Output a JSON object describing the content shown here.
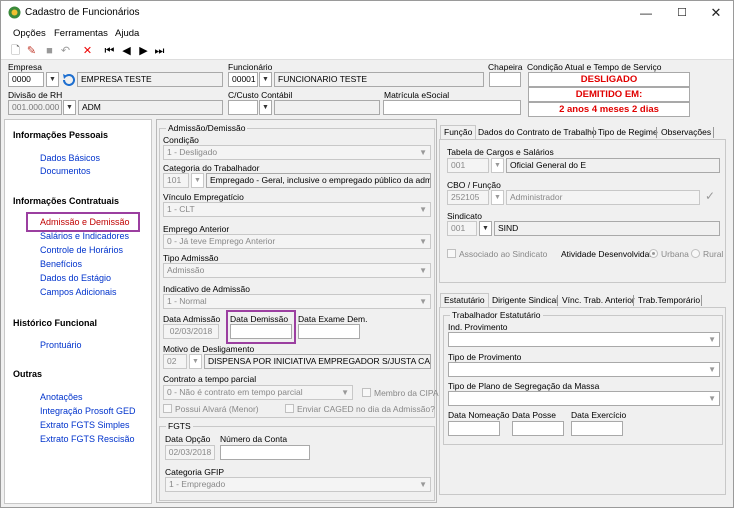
{
  "window": {
    "title": "Cadastro de Funcionários"
  },
  "menu": {
    "opcoes": "Opções",
    "ferramentas": "Ferramentas",
    "ajuda": "Ajuda"
  },
  "header": {
    "empresa_label": "Empresa",
    "empresa_code": "0000",
    "empresa_name": "EMPRESA TESTE",
    "funcionario_label": "Funcionário",
    "funcionario_code": "00001",
    "funcionario_name": "FUNCIONARIO TESTE",
    "chapeira_label": "Chapeira",
    "condicao_label": "Condição Atual e Tempo de Serviço",
    "status1": "DESLIGADO",
    "status2": "DEMITIDO EM:",
    "status3": "2 anos 4 meses 2 dias",
    "divisao_label": "Divisão de RH",
    "divisao_code": "001.000.000",
    "divisao_name": "ADM",
    "ccusto_label": "C/Custo Contábil",
    "matricula_label": "Matrícula eSocial"
  },
  "sidebar": {
    "pessoais": "Informações Pessoais",
    "dados_basicos": "Dados Básicos",
    "documentos": "Documentos",
    "contratuais": "Informações Contratuais",
    "admissao": "Admissão e Demissão",
    "salarios": "Salários e Indicadores",
    "horarios": "Controle de Horários",
    "beneficios": "Benefícios",
    "estagio": "Dados do Estágio",
    "campos": "Campos Adicionais",
    "historico": "Histórico Funcional",
    "prontuario": "Prontuário",
    "outras": "Outras",
    "anotacoes": "Anotações",
    "integracao": "Integração Prosoft GED",
    "fgts_simples": "Extrato FGTS Simples",
    "fgts_rescisao": "Extrato FGTS Rescisão"
  },
  "adm": {
    "group": "Admissão/Demissão",
    "condicao_label": "Condição",
    "condicao": "1 - Desligado",
    "categoria_label": "Categoria do Trabalhador",
    "categoria_code": "101",
    "categoria": "Empregado - Geral, inclusive o empregado público da administ",
    "vinculo_label": "Vínculo Empregatício",
    "vinculo": "1 - CLT",
    "emprego_label": "Emprego Anterior",
    "emprego": "0 - Já teve Emprego Anterior",
    "tipo_label": "Tipo Admissão",
    "tipo": "Admissão",
    "indicativo_label": "Indicativo de Admissão",
    "indicativo": "1 - Normal",
    "data_adm_label": "Data Admissão",
    "data_adm": "02/03/2018",
    "data_dem_label": "Data Demissão",
    "data_exame_label": "Data Exame Dem.",
    "motivo_label": "Motivo de Desligamento",
    "motivo_code": "02",
    "motivo": "DISPENSA POR INICIATIVA EMPREGADOR S/JUSTA CAUSA",
    "contrato_label": "Contrato a tempo parcial",
    "contrato": "0 - Não é contrato em tempo parcial",
    "cipa": "Membro da CIPA",
    "alvara": "Possui Alvará (Menor)",
    "caged": "Enviar CAGED no dia da Admissão?"
  },
  "fgts": {
    "group": "FGTS",
    "data_opcao_label": "Data Opção",
    "data_opcao": "02/03/2018",
    "conta_label": "Número da Conta",
    "gfip_label": "Categoria GFIP",
    "gfip": "1 - Empregado"
  },
  "tabs_top": {
    "funcao": "Função",
    "contrato": "Dados do Contrato de Trabalho",
    "regime": "Tipo de Regime",
    "obs": "Observações"
  },
  "funcao": {
    "tabela_label": "Tabela de Cargos e Salários",
    "tabela_code": "001",
    "tabela": "Oficial General do E",
    "cbo_label": "CBO / Função",
    "cbo_code": "252105",
    "cbo": "Administrador",
    "sindicato_label": "Sindicato",
    "sindicato_code": "001",
    "sindicato": "SIND",
    "associado": "Associado ao Sindicato",
    "atividade": "Atividade Desenvolvida:",
    "urbana": "Urbana",
    "rural": "Rural"
  },
  "tabs_bottom": {
    "estatutario": "Estatutário",
    "dirigente": "Dirigente Sindical",
    "vinc": "Vínc. Trab. Anterior",
    "temporario": "Trab.Temporário"
  },
  "estat": {
    "group": "Trabalhador Estatutário",
    "ind_label": "Ind. Provimento",
    "tipo_label": "Tipo de Provimento",
    "plano_label": "Tipo de Plano de Segregação da Massa",
    "nomeacao": "Data Nomeação",
    "posse": "Data Posse",
    "exercicio": "Data Exercício"
  },
  "colors": {
    "accent": "#9b3fa0",
    "link": "#0033cc",
    "status": "#e00000"
  }
}
